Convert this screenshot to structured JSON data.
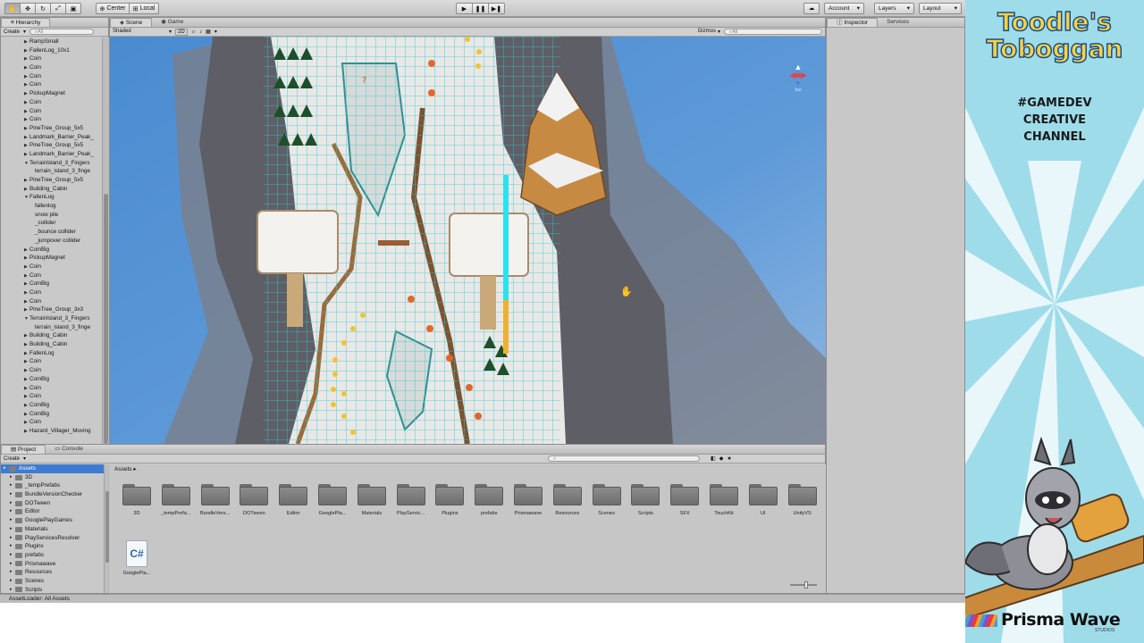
{
  "toolbar": {
    "pivot_label": "Center",
    "space_label": "Local",
    "account_label": "Account",
    "layers_label": "Layers",
    "layout_label": "Layout"
  },
  "hierarchy": {
    "tab": "Hierarchy",
    "create_label": "Create",
    "search_placeholder": "All",
    "rows": [
      {
        "label": "RampSmall",
        "indent": 1,
        "arrow": "▶"
      },
      {
        "label": "FallenLog_10x1",
        "indent": 1,
        "arrow": "▶"
      },
      {
        "label": "Coin",
        "indent": 1,
        "arrow": "▶"
      },
      {
        "label": "Coin",
        "indent": 1,
        "arrow": "▶"
      },
      {
        "label": "Coin",
        "indent": 1,
        "arrow": "▶"
      },
      {
        "label": "Coin",
        "indent": 1,
        "arrow": "▶"
      },
      {
        "label": "PickupMagnet",
        "indent": 1,
        "arrow": "▶"
      },
      {
        "label": "Coin",
        "indent": 1,
        "arrow": "▶"
      },
      {
        "label": "Coin",
        "indent": 1,
        "arrow": "▶"
      },
      {
        "label": "Coin",
        "indent": 1,
        "arrow": "▶"
      },
      {
        "label": "PineTree_Group_5x5",
        "indent": 1,
        "arrow": "▶"
      },
      {
        "label": "Landmark_Barrier_Peak_",
        "indent": 1,
        "arrow": "▶"
      },
      {
        "label": "PineTree_Group_5x5",
        "indent": 1,
        "arrow": "▶"
      },
      {
        "label": "Landmark_Barrier_Peak_",
        "indent": 1,
        "arrow": "▶"
      },
      {
        "label": "TerrainIsland_3_Fingers",
        "indent": 1,
        "arrow": "▼"
      },
      {
        "label": "terrain_island_3_finge",
        "indent": 2,
        "arrow": ""
      },
      {
        "label": "PineTree_Group_5x5",
        "indent": 1,
        "arrow": "▶"
      },
      {
        "label": "Building_Cabin",
        "indent": 1,
        "arrow": "▶"
      },
      {
        "label": "FallenLog",
        "indent": 1,
        "arrow": "▼"
      },
      {
        "label": "fallenlog",
        "indent": 2,
        "arrow": ""
      },
      {
        "label": "snow pile",
        "indent": 2,
        "arrow": ""
      },
      {
        "label": "_collider",
        "indent": 2,
        "arrow": ""
      },
      {
        "label": "_bounce collider",
        "indent": 2,
        "arrow": ""
      },
      {
        "label": "_jumpover collider",
        "indent": 2,
        "arrow": ""
      },
      {
        "label": "CoinBig",
        "indent": 1,
        "arrow": "▶"
      },
      {
        "label": "PickupMagnet",
        "indent": 1,
        "arrow": "▶"
      },
      {
        "label": "Coin",
        "indent": 1,
        "arrow": "▶"
      },
      {
        "label": "Coin",
        "indent": 1,
        "arrow": "▶"
      },
      {
        "label": "CoinBig",
        "indent": 1,
        "arrow": "▶"
      },
      {
        "label": "Coin",
        "indent": 1,
        "arrow": "▶"
      },
      {
        "label": "Coin",
        "indent": 1,
        "arrow": "▶"
      },
      {
        "label": "PineTree_Group_3x3",
        "indent": 1,
        "arrow": "▶"
      },
      {
        "label": "TerrainIsland_3_Fingers",
        "indent": 1,
        "arrow": "▼"
      },
      {
        "label": "terrain_island_3_finge",
        "indent": 2,
        "arrow": ""
      },
      {
        "label": "Building_Cabin",
        "indent": 1,
        "arrow": "▶"
      },
      {
        "label": "Building_Cabin",
        "indent": 1,
        "arrow": "▶"
      },
      {
        "label": "FallenLog",
        "indent": 1,
        "arrow": "▶"
      },
      {
        "label": "Coin",
        "indent": 1,
        "arrow": "▶"
      },
      {
        "label": "Coin",
        "indent": 1,
        "arrow": "▶"
      },
      {
        "label": "CoinBig",
        "indent": 1,
        "arrow": "▶"
      },
      {
        "label": "Coin",
        "indent": 1,
        "arrow": "▶"
      },
      {
        "label": "Coin",
        "indent": 1,
        "arrow": "▶"
      },
      {
        "label": "CoinBig",
        "indent": 1,
        "arrow": "▶"
      },
      {
        "label": "CoinBig",
        "indent": 1,
        "arrow": "▶"
      },
      {
        "label": "Coin",
        "indent": 1,
        "arrow": "▶"
      },
      {
        "label": "Hazard_Villager_Moving",
        "indent": 1,
        "arrow": "▶"
      }
    ]
  },
  "scene": {
    "tab_scene": "Scene",
    "tab_game": "Game",
    "shading": "Shaded",
    "mode_2d": "2D",
    "gizmos_label": "Gizmos",
    "search_placeholder": "All",
    "view_label": "Iso"
  },
  "inspector": {
    "tab_inspector": "Inspector",
    "tab_services": "Services"
  },
  "project": {
    "tab_project": "Project",
    "tab_console": "Console",
    "create_label": "Create",
    "breadcrumb": "Assets",
    "tree": [
      {
        "label": "Assets",
        "indent": 0,
        "selected": true
      },
      {
        "label": "3D",
        "indent": 1
      },
      {
        "label": "_tempPrefabs",
        "indent": 1
      },
      {
        "label": "BundleVersionChecker",
        "indent": 1
      },
      {
        "label": "DOTween",
        "indent": 1
      },
      {
        "label": "Editor",
        "indent": 1
      },
      {
        "label": "GooglePlayGames",
        "indent": 1
      },
      {
        "label": "Materials",
        "indent": 1
      },
      {
        "label": "PlayServicesResolver",
        "indent": 1
      },
      {
        "label": "Plugins",
        "indent": 1
      },
      {
        "label": "prefabs",
        "indent": 1
      },
      {
        "label": "Prismawave",
        "indent": 1
      },
      {
        "label": "Resources",
        "indent": 1
      },
      {
        "label": "Scenes",
        "indent": 1
      },
      {
        "label": "Scripts",
        "indent": 1
      }
    ],
    "folders": [
      "3D",
      "_tempPrefa...",
      "BundleVers...",
      "DOTween",
      "Editor",
      "GooglePla...",
      "Materials",
      "PlayServic...",
      "Plugins",
      "prefabs",
      "Prismawave",
      "Resources",
      "Scenes",
      "Scripts",
      "SFX",
      "TouchKit",
      "UI",
      "UnityVS"
    ],
    "script_label": "GooglePla..."
  },
  "status": "AssetLoader: All Assets",
  "sidebar": {
    "logo_line1": "Toodle's",
    "logo_line2": "Toboggan",
    "tagline_1": "#GAMEDEV",
    "tagline_2": "CREATIVE",
    "tagline_3": "CHANNEL",
    "studio_name": "Prisma Wave",
    "studio_sub": "STUDIOS"
  }
}
